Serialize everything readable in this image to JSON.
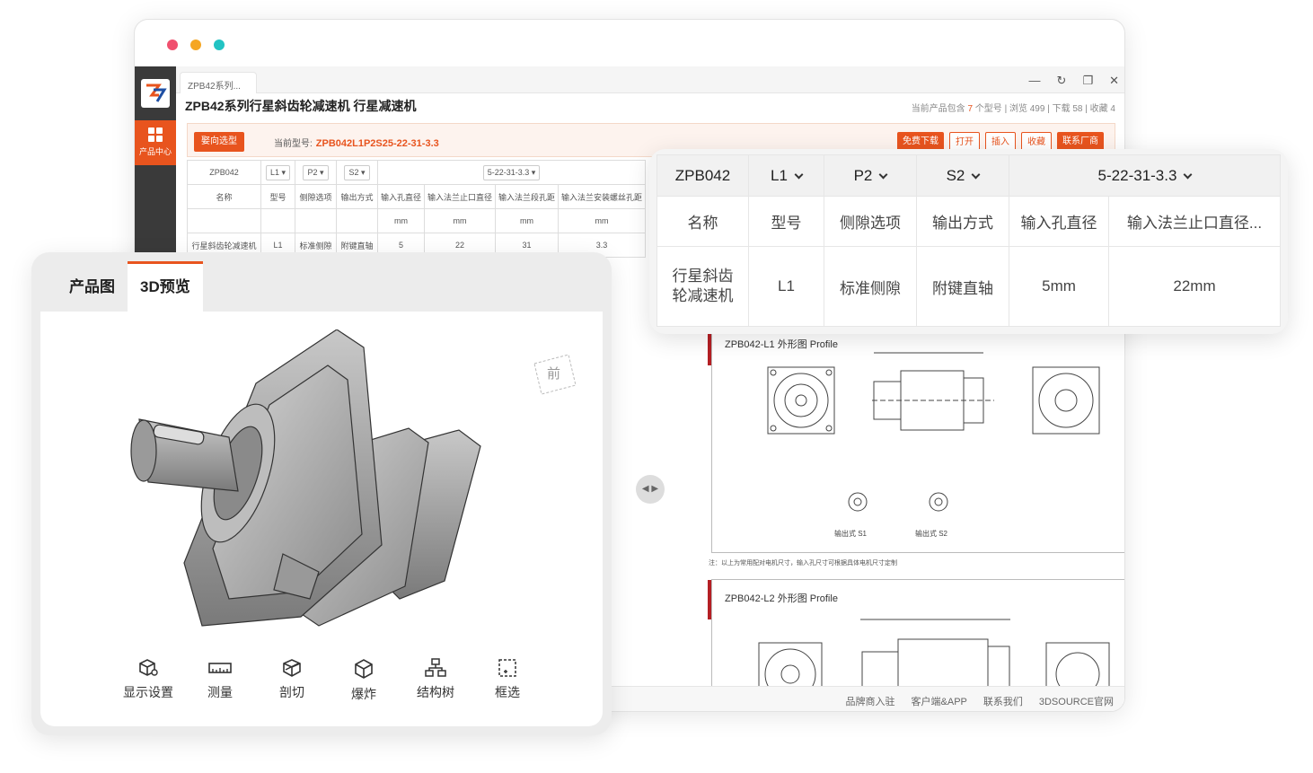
{
  "window": {
    "dot_colors": [
      "#f0506e",
      "#f5a623",
      "#22c3c3"
    ],
    "tab_label": "ZPB42系列...",
    "controls": [
      "—",
      "↻",
      "❐",
      "✕"
    ]
  },
  "rail": {
    "item_label": "产品中心"
  },
  "product": {
    "title": "ZPB42系列行星斜齿轮减速机 行星减速机",
    "stats": {
      "prefix": "当前产品包含",
      "count": "7",
      "suffix": "个型号",
      "views": "浏览 499",
      "downloads": "下载 58",
      "favorites": "收藏 4"
    }
  },
  "selection_bar": {
    "back_button": "娶向选型",
    "current_label": "当前型号:",
    "current_model": "ZPB042L1P2S25-22-31-3.3",
    "actions": [
      "免费下载",
      "打开",
      "插入",
      "收藏",
      "联系厂商"
    ]
  },
  "bg_table": {
    "selectors": [
      "ZPB042",
      "L1",
      "P2",
      "S2",
      "5-22-31-3.3"
    ],
    "headers": [
      "名称",
      "型号",
      "侧隙选项",
      "输出方式",
      "输入孔直径",
      "输入法兰止口直径",
      "输入法兰段孔距",
      "输入法兰安装螺丝孔距"
    ],
    "units": [
      "",
      "",
      "",
      "",
      "mm",
      "mm",
      "mm",
      "mm"
    ],
    "row": [
      "行星斜齿轮减速机",
      "L1",
      "标准侧隙",
      "附键直轴",
      "5",
      "22",
      "31",
      "3.3"
    ]
  },
  "drawings": {
    "profile1": "ZPB042-L1 外形图 Profile",
    "profile2": "ZPB042-L2 外形图 Profile",
    "note": "注：以上为常用配对电机尺寸，输入孔尺寸可根据具体电机尺寸定制",
    "label_s1": "输出式 S1",
    "label_s2": "输出式 S2"
  },
  "footer": {
    "links": [
      "品牌商入驻",
      "客户端&APP",
      "联系我们",
      "3DSOURCE官网"
    ]
  },
  "preview_card": {
    "tabs": [
      "产品图",
      "3D预览"
    ],
    "front_label": "前",
    "tools": [
      {
        "label": "显示设置",
        "icon": "cube-settings-icon"
      },
      {
        "label": "测量",
        "icon": "ruler-icon"
      },
      {
        "label": "剖切",
        "icon": "section-cut-icon"
      },
      {
        "label": "爆炸",
        "icon": "explode-icon"
      },
      {
        "label": "结构树",
        "icon": "structure-tree-icon"
      },
      {
        "label": "框选",
        "icon": "box-select-icon"
      }
    ]
  },
  "spec_card": {
    "selectors": [
      "ZPB042",
      "L1",
      "P2",
      "S2",
      "5-22-31-3.3"
    ],
    "headers": [
      "名称",
      "型号",
      "侧隙选项",
      "输出方式",
      "输入孔直径",
      "输入法兰止口直径..."
    ],
    "row": [
      "行星斜齿轮减速机",
      "L1",
      "标准侧隙",
      "附键直轴",
      "5mm",
      "22mm"
    ]
  },
  "colors": {
    "accent": "#e8541e",
    "rail": "#3a3a3a",
    "drawing_mark": "#b41f24"
  }
}
